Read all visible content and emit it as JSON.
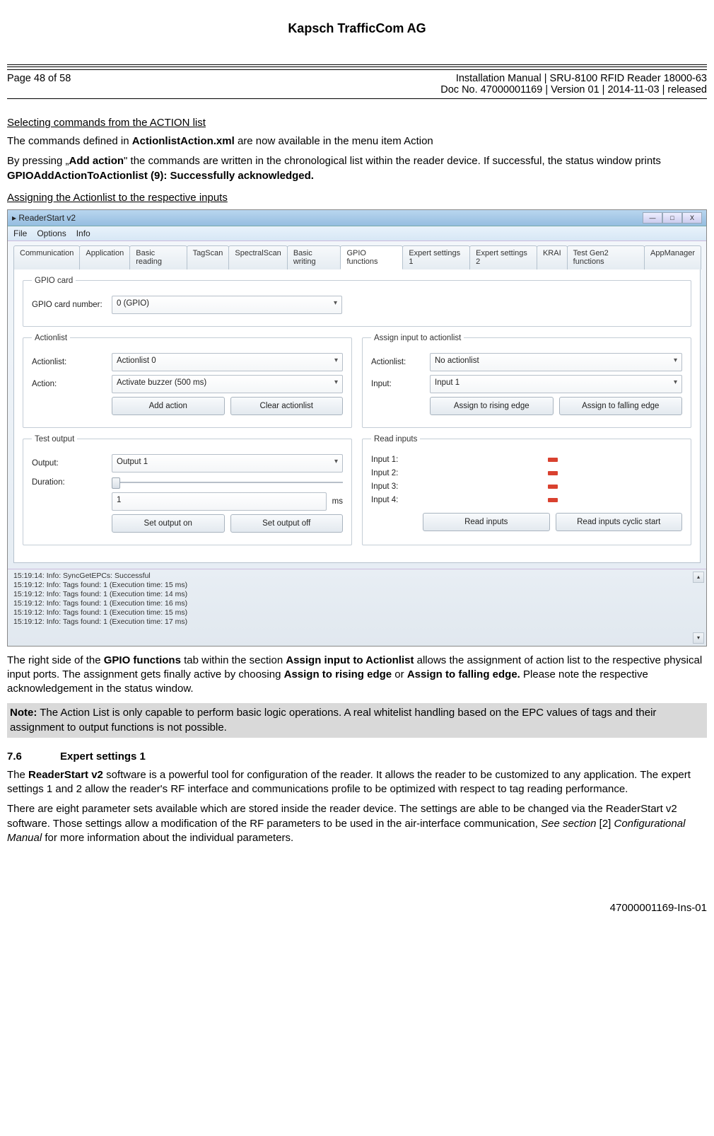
{
  "company": "Kapsch TrafficCom AG",
  "page_info": "Page 48 of 58",
  "doc_title": "Installation Manual | SRU-8100 RFID Reader 18000-63",
  "doc_meta": "Doc No. 47000001169 | Version 01 | 2014-11-03 | released",
  "heading_select": "Selecting commands from the ACTION list",
  "para1_a": "The commands defined in ",
  "para1_b": "ActionlistAction.xml",
  "para1_c": " are now available in the menu item Action",
  "para2_a": "By pressing „",
  "para2_b": "Add action",
  "para2_c": "\" the commands are written in the chronological list within the reader device. If successful, the status window prints ",
  "para2_d": "GPIOAddActionToActionlist (9): Successfully acknowledged.",
  "heading_assign": "Assigning the Actionlist to the respective inputs",
  "window": {
    "title": "ReaderStart v2",
    "menu": {
      "file": "File",
      "options": "Options",
      "info": "Info"
    },
    "tabs": {
      "comm": "Communication",
      "app": "Application",
      "basicr": "Basic reading",
      "tagscan": "TagScan",
      "spectral": "SpectralScan",
      "basicw": "Basic writing",
      "gpio": "GPIO functions",
      "exp1": "Expert settings 1",
      "exp2": "Expert settings 2",
      "krai": "KRAI",
      "tgen2": "Test Gen2 functions",
      "appmgr": "AppManager"
    },
    "gpio_card": {
      "legend": "GPIO card",
      "label": "GPIO card number:",
      "value": "0 (GPIO)"
    },
    "actionlist": {
      "legend": "Actionlist",
      "al_label": "Actionlist:",
      "al_value": "Actionlist 0",
      "ac_label": "Action:",
      "ac_value": "Activate buzzer (500 ms)",
      "btn_add": "Add action",
      "btn_clear": "Clear actionlist"
    },
    "assign": {
      "legend": "Assign input to actionlist",
      "al_label": "Actionlist:",
      "al_value": "No actionlist",
      "in_label": "Input:",
      "in_value": "Input 1",
      "btn_rise": "Assign to rising edge",
      "btn_fall": "Assign to falling edge"
    },
    "testout": {
      "legend": "Test output",
      "out_label": "Output:",
      "out_value": "Output 1",
      "dur_label": "Duration:",
      "dur_value": "1",
      "dur_unit": "ms",
      "btn_on": "Set output on",
      "btn_off": "Set output off"
    },
    "readin": {
      "legend": "Read inputs",
      "i1": "Input 1:",
      "i2": "Input 2:",
      "i3": "Input 3:",
      "i4": "Input 4:",
      "btn_read": "Read inputs",
      "btn_cyclic": "Read inputs cyclic start"
    },
    "log": {
      "l1": "15:19:14: Info: SyncGetEPCs: Successful",
      "l2": "15:19:12: Info: Tags found: 1 (Execution time: 15 ms)",
      "l3": "15:19:12: Info: Tags found: 1 (Execution time: 14 ms)",
      "l4": "15:19:12: Info: Tags found: 1 (Execution time: 16 ms)",
      "l5": "15:19:12: Info: Tags found: 1 (Execution time: 15 ms)",
      "l6": "15:19:12: Info: Tags found: 1 (Execution time: 17 ms)"
    }
  },
  "para3": "The right side of the <b>GPIO functions</b> tab within the section <b>Assign input to Actionlist</b> allows the assignment of action list to the respective physical input ports. The assignment gets finally active by choosing <b>Assign to rising edge</b> or <b>Assign to falling edge.</b> Please note the respective acknowledgement in the status window.",
  "note": "<b>Note:</b> The Action List is only capable to perform basic logic operations. A real whitelist handling based on the EPC values of tags and their assignment to output functions is not possible.",
  "sec76_num": "7.6",
  "sec76_title": "Expert settings 1",
  "para4": "The <b>ReaderStart v2</b> software is a powerful tool for configuration of the reader. It allows the reader to be customized to any application. The expert settings 1 and 2 allow the reader's RF interface and communications profile to be optimized with respect to tag reading performance.",
  "para5": "There are eight parameter sets available which are stored inside the reader device. The settings are able to be changed via the ReaderStart v2 software. Those settings allow a modification of the RF parameters to be used in the air-interface communication, <i>See section</i> [2] <i>Configurational Manual</i> for more information about the individual parameters.",
  "footer_id": "47000001169-Ins-01"
}
